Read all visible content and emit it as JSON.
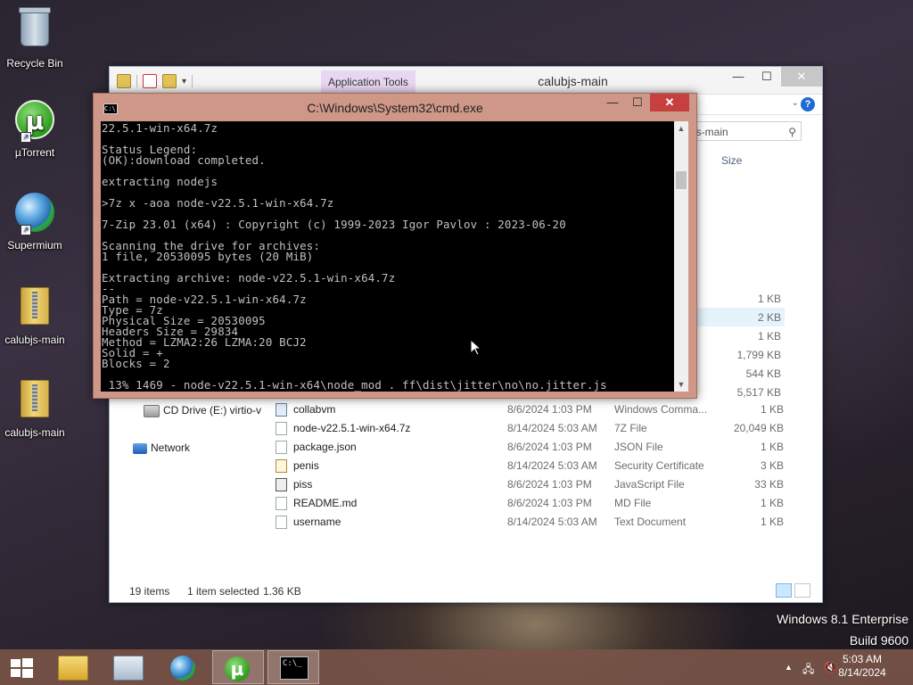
{
  "desktop": {
    "icons": [
      {
        "label": "Recycle Bin"
      },
      {
        "label": "µTorrent"
      },
      {
        "label": "Supermium"
      },
      {
        "label": "calubjs-main"
      },
      {
        "label": "calubjs-main"
      }
    ],
    "watermark": {
      "line1": "Windows 8.1 Enterprise",
      "line2": "Build 9600"
    }
  },
  "explorer": {
    "title": "calubjs-main",
    "context_tab": "Application Tools",
    "search_placeholder": "Search calubjs-main",
    "search_visible": "js-main",
    "column_size": "Size",
    "sidebar": {
      "cd_drive": "CD Drive (E:) virtio-v",
      "network": "Network"
    },
    "partial_sizes": [
      "1 KB",
      "2 KB",
      "1 KB",
      "1,799 KB",
      "544 KB",
      "5,517 KB"
    ],
    "files": [
      {
        "name": "collabvm",
        "date": "8/6/2024 1:03 PM",
        "type": "Windows Comma...",
        "size": "1 KB"
      },
      {
        "name": "node-v22.5.1-win-x64.7z",
        "date": "8/14/2024 5:03 AM",
        "type": "7Z File",
        "size": "20,049 KB"
      },
      {
        "name": "package.json",
        "date": "8/6/2024 1:03 PM",
        "type": "JSON File",
        "size": "1 KB"
      },
      {
        "name": "penis",
        "date": "8/14/2024 5:03 AM",
        "type": "Security Certificate",
        "size": "3 KB"
      },
      {
        "name": "piss",
        "date": "8/6/2024 1:03 PM",
        "type": "JavaScript File",
        "size": "33 KB"
      },
      {
        "name": "README.md",
        "date": "8/6/2024 1:03 PM",
        "type": "MD File",
        "size": "1 KB"
      },
      {
        "name": "username",
        "date": "8/14/2024 5:03 AM",
        "type": "Text Document",
        "size": "1 KB"
      }
    ],
    "status": {
      "items": "19 items",
      "selected": "1 item selected",
      "selected_size": "1.36 KB"
    }
  },
  "cmd": {
    "title": "C:\\Windows\\System32\\cmd.exe",
    "lines": [
      "22.5.1-win-x64.7z",
      "",
      "Status Legend:",
      "(OK):download completed.",
      "",
      "extracting nodejs",
      "",
      ">7z x -aoa node-v22.5.1-win-x64.7z",
      "",
      "7-Zip 23.01 (x64) : Copyright (c) 1999-2023 Igor Pavlov : 2023-06-20",
      "",
      "Scanning the drive for archives:",
      "1 file, 20530095 bytes (20 MiB)",
      "",
      "Extracting archive: node-v22.5.1-win-x64.7z",
      "--",
      "Path = node-v22.5.1-win-x64.7z",
      "Type = 7z",
      "Physical Size = 20530095",
      "Headers Size = 29834",
      "Method = LZMA2:26 LZMA:20 BCJ2",
      "Solid = +",
      "Blocks = 2",
      "",
      " 13% 1469 - node-v22.5.1-win-x64\\node_mod . ff\\dist\\jitter\\no\\no.jitter.js"
    ]
  },
  "taskbar": {
    "time": "5:03 AM",
    "date": "8/14/2024"
  }
}
